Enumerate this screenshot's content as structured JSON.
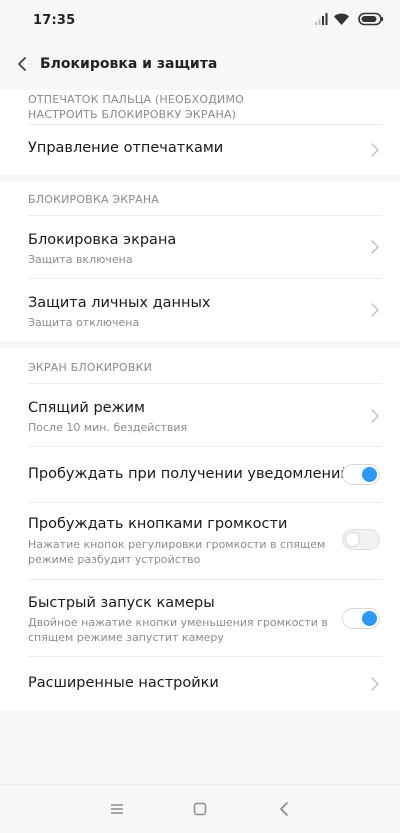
{
  "status_bar": {
    "time": "17:35"
  },
  "header": {
    "title": "Блокировка и защита"
  },
  "sections": {
    "fingerprint": {
      "header": "ОТПЕЧАТОК ПАЛЬЦА (НЕОБХОДИМО НАСТРОИТЬ БЛОКИРОВКУ ЭКРАНА)",
      "items": [
        {
          "title": "Управление отпечатками"
        }
      ]
    },
    "screen_lock": {
      "header": "БЛОКИРОВКА ЭКРАНА",
      "items": [
        {
          "title": "Блокировка экрана",
          "subtitle": "Защита включена"
        },
        {
          "title": "Защита личных данных",
          "subtitle": "Защита отключена"
        }
      ]
    },
    "lock_screen": {
      "header": "ЭКРАН БЛОКИРОВКИ",
      "items": [
        {
          "title": "Спящий режим",
          "subtitle": "После 10 мин. бездействия"
        },
        {
          "title": "Пробуждать при получении уведомлений",
          "toggle": true
        },
        {
          "title": "Пробуждать кнопками громкости",
          "subtitle": "Нажатие кнопок регулировки громкости в спящем режиме разбудит устройство",
          "toggle": false
        },
        {
          "title": "Быстрый запуск камеры",
          "subtitle": "Двойное нажатие кнопки уменьшения громкости в спящем режиме запустит камеру",
          "toggle": true
        },
        {
          "title": "Расширенные настройки"
        }
      ]
    }
  },
  "icons": {
    "status": [
      "signal-icon",
      "wifi-icon",
      "battery-icon"
    ],
    "nav": [
      "menu-icon",
      "home-icon",
      "back-icon"
    ],
    "accent": "#2c97f5"
  }
}
